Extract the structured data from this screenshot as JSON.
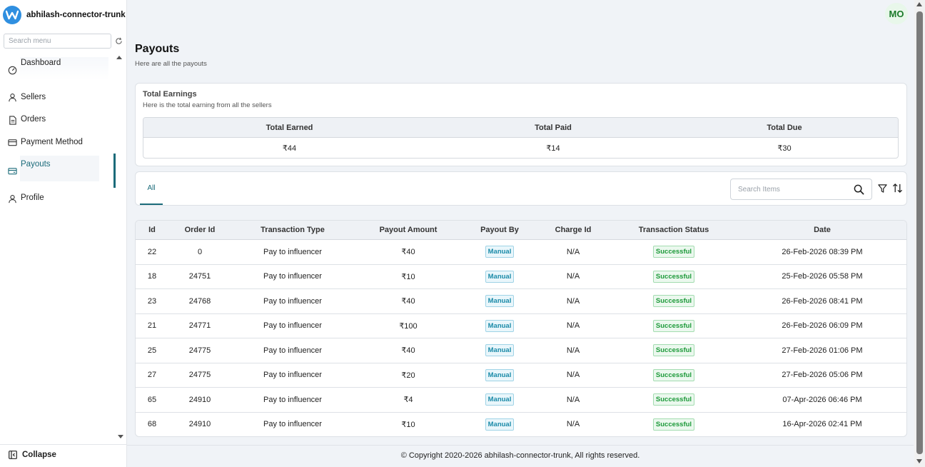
{
  "brand": {
    "name": "abhilash-connector-trunk",
    "logo_icon": "brand-logo-icon",
    "logo_color": "#2f8fe0"
  },
  "sidebar": {
    "search_placeholder": "Search menu",
    "items": [
      {
        "label": "Dashboard",
        "icon": "dashboard-icon"
      },
      {
        "label": "Sellers",
        "icon": "user-icon"
      },
      {
        "label": "Orders",
        "icon": "document-icon"
      },
      {
        "label": "Payment Method",
        "icon": "card-icon"
      },
      {
        "label": "Payouts",
        "icon": "wallet-icon",
        "active": true
      },
      {
        "label": "Profile",
        "icon": "user-icon"
      }
    ],
    "collapse_label": "Collapse"
  },
  "header": {
    "avatar_initials": "MO"
  },
  "page": {
    "title": "Payouts",
    "subtitle": "Here are all the payouts"
  },
  "earnings": {
    "title": "Total Earnings",
    "subtitle": "Here is the total earning from all the sellers",
    "columns": [
      "Total Earned",
      "Total Paid",
      "Total Due"
    ],
    "values": [
      "₹44",
      "₹14",
      "₹30"
    ]
  },
  "tabs": [
    {
      "label": "All",
      "active": true
    }
  ],
  "search": {
    "placeholder": "Search Items"
  },
  "table": {
    "columns": [
      "Id",
      "Order Id",
      "Transaction Type",
      "Payout Amount",
      "Payout By",
      "Charge Id",
      "Transaction Status",
      "Date"
    ],
    "rows": [
      [
        "22",
        "0",
        "Pay to influencer",
        "₹40",
        "Manual",
        "N/A",
        "Successful",
        "26-Feb-2026 08:39 PM"
      ],
      [
        "18",
        "24751",
        "Pay to influencer",
        "₹10",
        "Manual",
        "N/A",
        "Successful",
        "25-Feb-2026 05:58 PM"
      ],
      [
        "23",
        "24768",
        "Pay to influencer",
        "₹40",
        "Manual",
        "N/A",
        "Successful",
        "26-Feb-2026 08:41 PM"
      ],
      [
        "21",
        "24771",
        "Pay to influencer",
        "₹100",
        "Manual",
        "N/A",
        "Successful",
        "26-Feb-2026 06:09 PM"
      ],
      [
        "25",
        "24775",
        "Pay to influencer",
        "₹40",
        "Manual",
        "N/A",
        "Successful",
        "27-Feb-2026 01:06 PM"
      ],
      [
        "27",
        "24775",
        "Pay to influencer",
        "₹20",
        "Manual",
        "N/A",
        "Successful",
        "27-Feb-2026 05:06 PM"
      ],
      [
        "65",
        "24910",
        "Pay to influencer",
        "₹4",
        "Manual",
        "N/A",
        "Successful",
        "07-Apr-2026 06:46 PM"
      ],
      [
        "68",
        "24910",
        "Pay to influencer",
        "₹10",
        "Manual",
        "N/A",
        "Successful",
        "16-Apr-2026 02:41 PM"
      ]
    ]
  },
  "footer": {
    "copyright": "© Copyright 2020-2026 abhilash-connector-trunk, All rights reserved."
  },
  "colors": {
    "accent": "#1b6b7a",
    "manual_badge": "#1a8aa8",
    "success_badge": "#1d9a3a",
    "avatar_text": "#1b7a2a"
  }
}
